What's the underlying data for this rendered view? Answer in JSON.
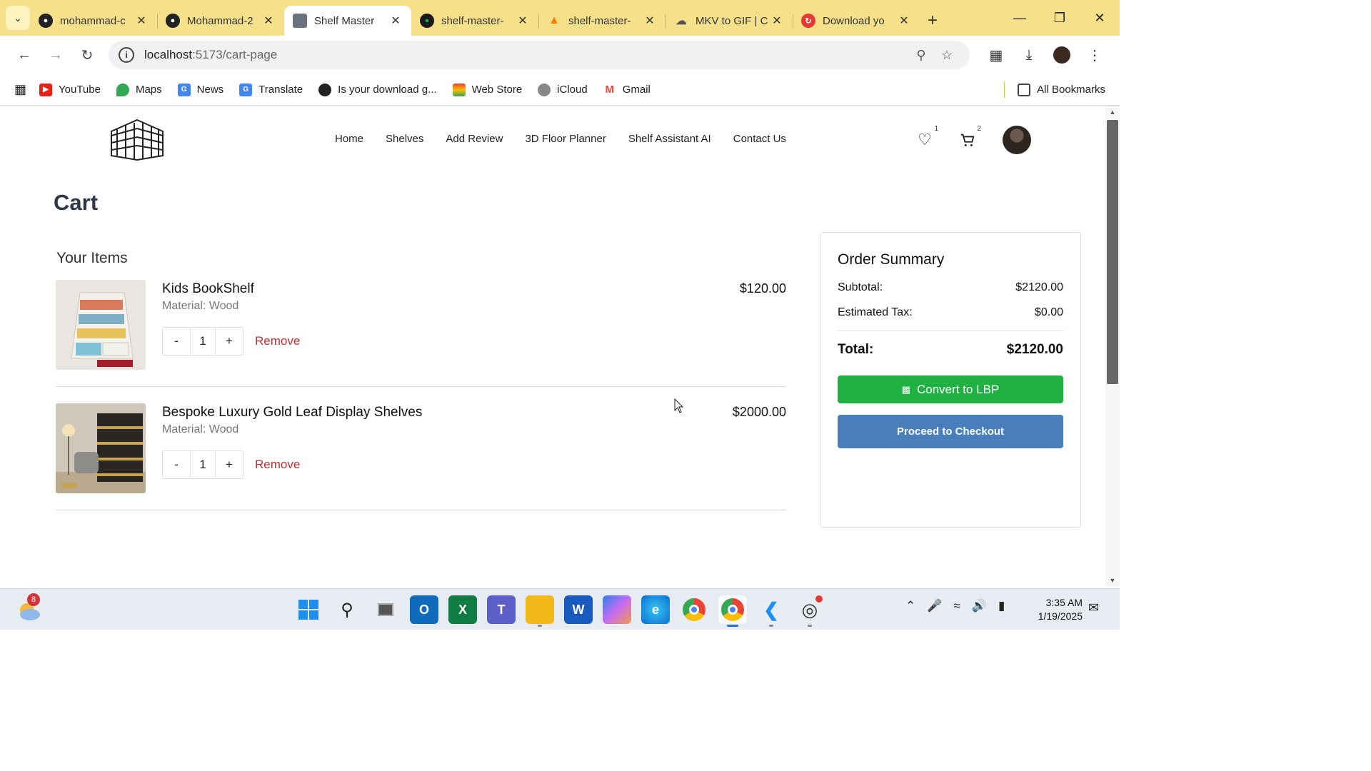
{
  "browser": {
    "tabs": [
      {
        "label": "mohammad-c",
        "icon": "github-icon",
        "active": false
      },
      {
        "label": "Mohammad-2",
        "icon": "github-icon",
        "active": false
      },
      {
        "label": "Shelf Master",
        "icon": "page-icon",
        "active": true
      },
      {
        "label": "shelf-master-",
        "icon": "mongodb-leaf-icon",
        "active": false
      },
      {
        "label": "shelf-master-",
        "icon": "firebase-icon",
        "active": false
      },
      {
        "label": "MKV to GIF | C",
        "icon": "cloud-icon",
        "active": false
      },
      {
        "label": "Download yo",
        "icon": "download-site-icon",
        "active": false
      }
    ],
    "url_host": "localhost",
    "url_path": ":5173/cart-page",
    "bookmarks": [
      "YouTube",
      "Maps",
      "News",
      "Translate",
      "Is your download g...",
      "Web Store",
      "iCloud",
      "Gmail"
    ],
    "all_bookmarks": "All Bookmarks"
  },
  "site": {
    "nav": [
      "Home",
      "Shelves",
      "Add Review",
      "3D Floor Planner",
      "Shelf Assistant AI",
      "Contact Us"
    ],
    "wishlist_count": "1",
    "cart_count": "2"
  },
  "cart": {
    "title": "Cart",
    "items_heading": "Your Items",
    "items": [
      {
        "name": "Kids BookShelf",
        "material": "Material: Wood",
        "price": "$120.00",
        "qty": "1",
        "remove": "Remove",
        "dec": "-",
        "inc": "+"
      },
      {
        "name": "Bespoke Luxury Gold Leaf Display Shelves",
        "material": "Material: Wood",
        "price": "$2000.00",
        "qty": "1",
        "remove": "Remove",
        "dec": "-",
        "inc": "+"
      }
    ]
  },
  "summary": {
    "title": "Order Summary",
    "subtotal_label": "Subtotal:",
    "subtotal": "$2120.00",
    "tax_label": "Estimated Tax:",
    "tax": "$0.00",
    "total_label": "Total:",
    "total": "$2120.00",
    "convert_label": "Convert to LBP",
    "checkout_label": "Proceed to Checkout"
  },
  "taskbar": {
    "weather_badge": "8",
    "time": "3:35 AM",
    "date": "1/19/2025"
  },
  "colors": {
    "tabbar": "#f7e08a",
    "convert_button": "#1fb141",
    "checkout_button": "#4a7fbd",
    "remove_text": "#b83232"
  }
}
